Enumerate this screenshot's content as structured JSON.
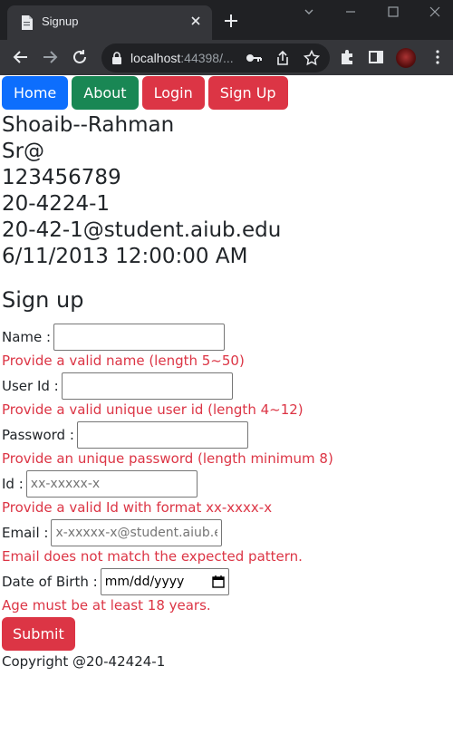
{
  "browser": {
    "tab_title": "Signup",
    "url_host": "localhost",
    "url_rest": ":44398/..."
  },
  "nav": {
    "home": "Home",
    "about": "About",
    "login": "Login",
    "signup": "Sign Up"
  },
  "profile": {
    "name": "Shoaib--Rahman",
    "username": "Sr@",
    "password": "123456789",
    "id": "20-4224-1",
    "email": "20-42-1@student.aiub.edu",
    "dob": "6/11/2013 12:00:00 AM"
  },
  "form": {
    "title": "Sign up",
    "name_label": "Name :",
    "name_error": "Provide a valid name (length 5~50)",
    "userid_label": "User Id :",
    "userid_error": "Provide a valid unique user id (length 4~12)",
    "password_label": "Password :",
    "password_error": "Provide an unique password (length minimum 8)",
    "id_label": "Id :",
    "id_placeholder": "xx-xxxxx-x",
    "id_error": "Provide a valid Id with format xx-xxxx-x",
    "email_label": "Email :",
    "email_placeholder": "x-xxxxx-x@student.aiub.edu",
    "email_error": "Email does not match the expected pattern.",
    "dob_label": "Date of Birth :",
    "dob_value": "mm/dd/yyyy",
    "dob_error": "Age must be at least 18 years.",
    "submit": "Submit"
  },
  "footer": {
    "copyright": "Copyright @20-42424-1"
  },
  "colors": {
    "primary": "#0d6efd",
    "success": "#198754",
    "danger": "#dc3545"
  }
}
